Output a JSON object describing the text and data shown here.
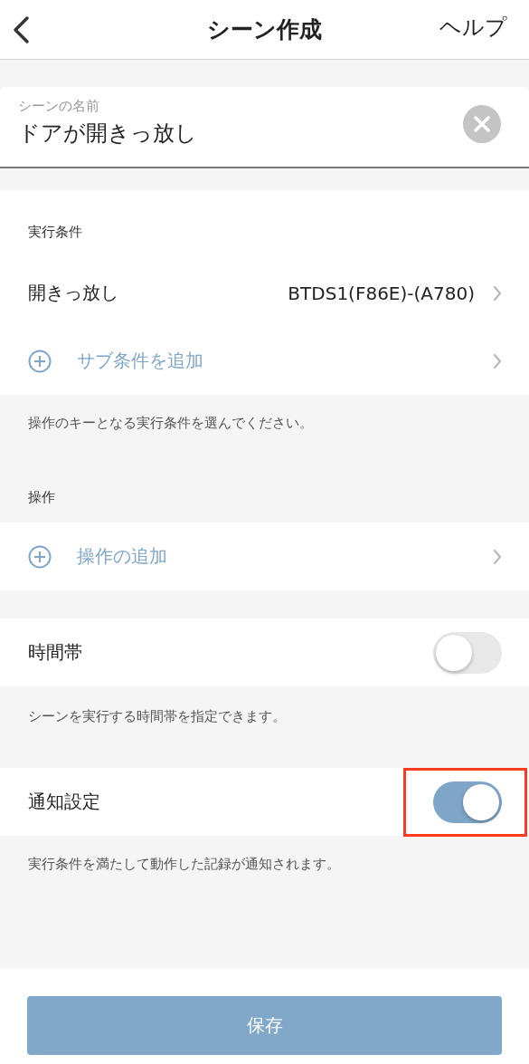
{
  "header": {
    "title": "シーン作成",
    "help": "ヘルプ"
  },
  "name_field": {
    "label": "シーンの名前",
    "value": "ドアが開きっ放し"
  },
  "blocks": [
    {
      "kind": "card_caption",
      "text": "実行条件"
    },
    {
      "kind": "value_row",
      "label": "開きっ放し",
      "value": "BTDS1(F86E)-(A780)"
    },
    {
      "kind": "add_row",
      "label": "サブ条件を追加"
    },
    {
      "kind": "hint",
      "text": "操作のキーとなる実行条件を選んでください。"
    },
    {
      "kind": "caption",
      "text": "操作"
    },
    {
      "kind": "add_row",
      "label": "操作の追加"
    },
    {
      "kind": "gap"
    },
    {
      "kind": "toggle_row",
      "label": "時間帯",
      "on": false,
      "highlighted": false
    },
    {
      "kind": "hint",
      "text": "シーンを実行する時間帯を指定できます。"
    },
    {
      "kind": "toggle_row",
      "label": "通知設定",
      "on": true,
      "highlighted": true
    },
    {
      "kind": "hint",
      "text": "実行条件を満たして動作した記録が通知されます。"
    }
  ],
  "save_button": {
    "label": "保存"
  }
}
